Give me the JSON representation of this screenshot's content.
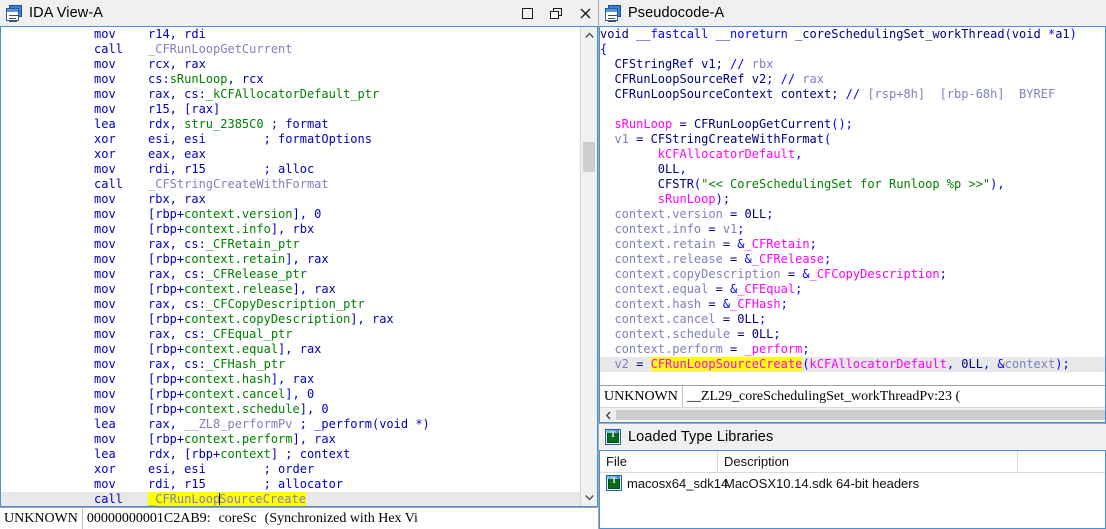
{
  "left_pane": {
    "title": "IDA View-A",
    "icon": "ida-view-icon",
    "window_buttons": {
      "maximize": "maximize-icon",
      "restore": "restore-icon",
      "close": "close-icon"
    },
    "disassembly": [
      {
        "mnemonic": "mov",
        "operands": [
          {
            "t": "reg",
            "v": "r14, rdi"
          }
        ]
      },
      {
        "mnemonic": "call",
        "operands": [
          {
            "t": "gsym",
            "v": "_CFRunLoopGetCurrent"
          }
        ]
      },
      {
        "mnemonic": "mov",
        "operands": [
          {
            "t": "reg",
            "v": "rcx, rax"
          }
        ]
      },
      {
        "mnemonic": "mov",
        "operands": [
          {
            "t": "reg",
            "v": "cs:"
          },
          {
            "t": "memb",
            "v": "sRunLoop"
          },
          {
            "t": "reg",
            "v": ", rcx"
          }
        ]
      },
      {
        "mnemonic": "mov",
        "operands": [
          {
            "t": "reg",
            "v": "rax, cs:"
          },
          {
            "t": "memb",
            "v": "_kCFAllocatorDefault_ptr"
          }
        ]
      },
      {
        "mnemonic": "mov",
        "operands": [
          {
            "t": "reg",
            "v": "r15, [rax]"
          }
        ]
      },
      {
        "mnemonic": "lea",
        "operands": [
          {
            "t": "reg",
            "v": "rdx, "
          },
          {
            "t": "memb",
            "v": "stru_2385C0"
          },
          {
            "t": "reg",
            "v": " ; "
          },
          {
            "t": "cmt",
            "v": "format"
          }
        ]
      },
      {
        "mnemonic": "xor",
        "operands": [
          {
            "t": "reg",
            "v": "esi, esi        ; "
          },
          {
            "t": "cmt",
            "v": "formatOptions"
          }
        ]
      },
      {
        "mnemonic": "xor",
        "operands": [
          {
            "t": "reg",
            "v": "eax, eax"
          }
        ]
      },
      {
        "mnemonic": "mov",
        "operands": [
          {
            "t": "reg",
            "v": "rdi, r15        ; "
          },
          {
            "t": "cmt",
            "v": "alloc"
          }
        ]
      },
      {
        "mnemonic": "call",
        "operands": [
          {
            "t": "gsym",
            "v": "_CFStringCreateWithFormat"
          }
        ]
      },
      {
        "mnemonic": "mov",
        "operands": [
          {
            "t": "reg",
            "v": "rbx, rax"
          }
        ]
      },
      {
        "mnemonic": "mov",
        "operands": [
          {
            "t": "reg",
            "v": "[rbp+"
          },
          {
            "t": "memb",
            "v": "context.version"
          },
          {
            "t": "reg",
            "v": "], 0"
          }
        ]
      },
      {
        "mnemonic": "mov",
        "operands": [
          {
            "t": "reg",
            "v": "[rbp+"
          },
          {
            "t": "memb",
            "v": "context.info"
          },
          {
            "t": "reg",
            "v": "], rbx"
          }
        ]
      },
      {
        "mnemonic": "mov",
        "operands": [
          {
            "t": "reg",
            "v": "rax, cs:"
          },
          {
            "t": "memb",
            "v": "_CFRetain_ptr"
          }
        ]
      },
      {
        "mnemonic": "mov",
        "operands": [
          {
            "t": "reg",
            "v": "[rbp+"
          },
          {
            "t": "memb",
            "v": "context.retain"
          },
          {
            "t": "reg",
            "v": "], rax"
          }
        ]
      },
      {
        "mnemonic": "mov",
        "operands": [
          {
            "t": "reg",
            "v": "rax, cs:"
          },
          {
            "t": "memb",
            "v": "_CFRelease_ptr"
          }
        ]
      },
      {
        "mnemonic": "mov",
        "operands": [
          {
            "t": "reg",
            "v": "[rbp+"
          },
          {
            "t": "memb",
            "v": "context.release"
          },
          {
            "t": "reg",
            "v": "], rax"
          }
        ]
      },
      {
        "mnemonic": "mov",
        "operands": [
          {
            "t": "reg",
            "v": "rax, cs:"
          },
          {
            "t": "memb",
            "v": "_CFCopyDescription_ptr"
          }
        ]
      },
      {
        "mnemonic": "mov",
        "operands": [
          {
            "t": "reg",
            "v": "[rbp+"
          },
          {
            "t": "memb",
            "v": "context.copyDescription"
          },
          {
            "t": "reg",
            "v": "], rax"
          }
        ]
      },
      {
        "mnemonic": "mov",
        "operands": [
          {
            "t": "reg",
            "v": "rax, cs:"
          },
          {
            "t": "memb",
            "v": "_CFEqual_ptr"
          }
        ]
      },
      {
        "mnemonic": "mov",
        "operands": [
          {
            "t": "reg",
            "v": "[rbp+"
          },
          {
            "t": "memb",
            "v": "context.equal"
          },
          {
            "t": "reg",
            "v": "], rax"
          }
        ]
      },
      {
        "mnemonic": "mov",
        "operands": [
          {
            "t": "reg",
            "v": "rax, cs:"
          },
          {
            "t": "memb",
            "v": "_CFHash_ptr"
          }
        ]
      },
      {
        "mnemonic": "mov",
        "operands": [
          {
            "t": "reg",
            "v": "[rbp+"
          },
          {
            "t": "memb",
            "v": "context.hash"
          },
          {
            "t": "reg",
            "v": "], rax"
          }
        ]
      },
      {
        "mnemonic": "mov",
        "operands": [
          {
            "t": "reg",
            "v": "[rbp+"
          },
          {
            "t": "memb",
            "v": "context.cancel"
          },
          {
            "t": "reg",
            "v": "], 0"
          }
        ]
      },
      {
        "mnemonic": "mov",
        "operands": [
          {
            "t": "reg",
            "v": "[rbp+"
          },
          {
            "t": "memb",
            "v": "context.schedule"
          },
          {
            "t": "reg",
            "v": "], 0"
          }
        ]
      },
      {
        "mnemonic": "lea",
        "operands": [
          {
            "t": "reg",
            "v": "rax, "
          },
          {
            "t": "gsym",
            "v": "__ZL8_performPv"
          },
          {
            "t": "reg",
            "v": " ; "
          },
          {
            "t": "cmt",
            "v": "_perform(void *)"
          }
        ]
      },
      {
        "mnemonic": "mov",
        "operands": [
          {
            "t": "reg",
            "v": "[rbp+"
          },
          {
            "t": "memb",
            "v": "context.perform"
          },
          {
            "t": "reg",
            "v": "], rax"
          }
        ]
      },
      {
        "mnemonic": "lea",
        "operands": [
          {
            "t": "reg",
            "v": "rdx, [rbp+"
          },
          {
            "t": "memb",
            "v": "context"
          },
          {
            "t": "reg",
            "v": "] ; "
          },
          {
            "t": "cmt",
            "v": "context"
          }
        ]
      },
      {
        "mnemonic": "xor",
        "operands": [
          {
            "t": "reg",
            "v": "esi, esi        ; "
          },
          {
            "t": "cmt",
            "v": "order"
          }
        ]
      },
      {
        "mnemonic": "mov",
        "operands": [
          {
            "t": "reg",
            "v": "rdi, r15        ; "
          },
          {
            "t": "cmt",
            "v": "allocator"
          }
        ]
      },
      {
        "mnemonic": "call",
        "operands": [
          {
            "t": "hl-gsym-caret",
            "v": "_CFRunLoopSourceCreate",
            "caret_after": 10
          }
        ],
        "current": true
      }
    ],
    "status": {
      "segment": "UNKNOWN",
      "address": "00000000001C2AB9:",
      "name": "coreSc",
      "sync": "(Synchronized with Hex Vi"
    }
  },
  "right_pane": {
    "pseudocode": {
      "title": "Pseudocode-A",
      "icon": "pseudocode-icon",
      "lines": [
        [
          {
            "t": "typ",
            "v": "void "
          },
          {
            "t": "kw",
            "v": "__fastcall __noreturn "
          },
          {
            "t": "typ",
            "v": "_coreSchedulingSet_workThread"
          },
          {
            "t": "punct",
            "v": "("
          },
          {
            "t": "typ",
            "v": "void "
          },
          {
            "t": "punct",
            "v": "*"
          },
          {
            "t": "lit",
            "v": "a1"
          },
          {
            "t": "punct",
            "v": ")"
          }
        ],
        [
          {
            "t": "punct",
            "v": "{"
          }
        ],
        [
          {
            "t": "plain",
            "v": "  "
          },
          {
            "t": "typ",
            "v": "CFStringRef v1; "
          },
          {
            "t": "cm",
            "v": "// "
          },
          {
            "t": "var",
            "v": "rbx"
          }
        ],
        [
          {
            "t": "plain",
            "v": "  "
          },
          {
            "t": "typ",
            "v": "CFRunLoopSourceRef v2; "
          },
          {
            "t": "cm",
            "v": "// "
          },
          {
            "t": "var",
            "v": "rax"
          }
        ],
        [
          {
            "t": "plain",
            "v": "  "
          },
          {
            "t": "typ",
            "v": "CFRunLoopSourceContext context; "
          },
          {
            "t": "cm",
            "v": "// "
          },
          {
            "t": "var",
            "v": "[rsp+8h]  [rbp-68h]  BYREF"
          }
        ],
        [],
        [
          {
            "t": "plain",
            "v": "  "
          },
          {
            "t": "glob",
            "v": "sRunLoop"
          },
          {
            "t": "typ",
            "v": " = "
          },
          {
            "t": "typ",
            "v": "CFRunLoopGetCurrent"
          },
          {
            "t": "punct",
            "v": "();"
          }
        ],
        [
          {
            "t": "plain",
            "v": "  "
          },
          {
            "t": "var",
            "v": "v1"
          },
          {
            "t": "typ",
            "v": " = "
          },
          {
            "t": "typ",
            "v": "CFStringCreateWithFormat"
          },
          {
            "t": "punct",
            "v": "("
          }
        ],
        [
          {
            "t": "plain",
            "v": "        "
          },
          {
            "t": "glob",
            "v": "kCFAllocatorDefault"
          },
          {
            "t": "punct",
            "v": ","
          }
        ],
        [
          {
            "t": "plain",
            "v": "        "
          },
          {
            "t": "lit",
            "v": "0LL"
          },
          {
            "t": "punct",
            "v": ","
          }
        ],
        [
          {
            "t": "plain",
            "v": "        "
          },
          {
            "t": "typ",
            "v": "CFSTR"
          },
          {
            "t": "punct",
            "v": "("
          },
          {
            "t": "str",
            "v": "\"<< CoreSchedulingSet for Runloop %p >>\""
          },
          {
            "t": "punct",
            "v": "),"
          }
        ],
        [
          {
            "t": "plain",
            "v": "        "
          },
          {
            "t": "glob",
            "v": "sRunLoop"
          },
          {
            "t": "punct",
            "v": ");"
          }
        ],
        [
          {
            "t": "plain",
            "v": "  "
          },
          {
            "t": "var",
            "v": "context.version"
          },
          {
            "t": "typ",
            "v": " = "
          },
          {
            "t": "lit",
            "v": "0LL"
          },
          {
            "t": "punct",
            "v": ";"
          }
        ],
        [
          {
            "t": "plain",
            "v": "  "
          },
          {
            "t": "var",
            "v": "context.info"
          },
          {
            "t": "typ",
            "v": " = "
          },
          {
            "t": "var",
            "v": "v1"
          },
          {
            "t": "punct",
            "v": ";"
          }
        ],
        [
          {
            "t": "plain",
            "v": "  "
          },
          {
            "t": "var",
            "v": "context.retain"
          },
          {
            "t": "typ",
            "v": " = "
          },
          {
            "t": "punct",
            "v": "&"
          },
          {
            "t": "glob",
            "v": "_CFRetain"
          },
          {
            "t": "punct",
            "v": ";"
          }
        ],
        [
          {
            "t": "plain",
            "v": "  "
          },
          {
            "t": "var",
            "v": "context.release"
          },
          {
            "t": "typ",
            "v": " = "
          },
          {
            "t": "punct",
            "v": "&"
          },
          {
            "t": "glob",
            "v": "_CFRelease"
          },
          {
            "t": "punct",
            "v": ";"
          }
        ],
        [
          {
            "t": "plain",
            "v": "  "
          },
          {
            "t": "var",
            "v": "context.copyDescription"
          },
          {
            "t": "typ",
            "v": " = "
          },
          {
            "t": "punct",
            "v": "&"
          },
          {
            "t": "glob",
            "v": "_CFCopyDescription"
          },
          {
            "t": "punct",
            "v": ";"
          }
        ],
        [
          {
            "t": "plain",
            "v": "  "
          },
          {
            "t": "var",
            "v": "context.equal"
          },
          {
            "t": "typ",
            "v": " = "
          },
          {
            "t": "punct",
            "v": "&"
          },
          {
            "t": "glob",
            "v": "_CFEqual"
          },
          {
            "t": "punct",
            "v": ";"
          }
        ],
        [
          {
            "t": "plain",
            "v": "  "
          },
          {
            "t": "var",
            "v": "context.hash"
          },
          {
            "t": "typ",
            "v": " = "
          },
          {
            "t": "punct",
            "v": "&"
          },
          {
            "t": "glob",
            "v": "_CFHash"
          },
          {
            "t": "punct",
            "v": ";"
          }
        ],
        [
          {
            "t": "plain",
            "v": "  "
          },
          {
            "t": "var",
            "v": "context.cancel"
          },
          {
            "t": "typ",
            "v": " = "
          },
          {
            "t": "lit",
            "v": "0LL"
          },
          {
            "t": "punct",
            "v": ";"
          }
        ],
        [
          {
            "t": "plain",
            "v": "  "
          },
          {
            "t": "var",
            "v": "context.schedule"
          },
          {
            "t": "typ",
            "v": " = "
          },
          {
            "t": "lit",
            "v": "0LL"
          },
          {
            "t": "punct",
            "v": ";"
          }
        ],
        [
          {
            "t": "plain",
            "v": "  "
          },
          {
            "t": "var",
            "v": "context.perform"
          },
          {
            "t": "typ",
            "v": " = "
          },
          {
            "t": "glob",
            "v": "_perform"
          },
          {
            "t": "punct",
            "v": ";"
          }
        ],
        [
          {
            "t": "plain",
            "v": "  "
          },
          {
            "t": "var",
            "v": "v2"
          },
          {
            "t": "typ",
            "v": " = "
          },
          {
            "t": "hl",
            "v": "CFRunLoopSourceCreate"
          },
          {
            "t": "punct",
            "v": "("
          },
          {
            "t": "glob",
            "v": "kCFAllocatorDefault"
          },
          {
            "t": "punct",
            "v": ", "
          },
          {
            "t": "lit",
            "v": "0LL"
          },
          {
            "t": "punct",
            "v": ", &"
          },
          {
            "t": "var",
            "v": "context"
          },
          {
            "t": "punct",
            "v": ");"
          }
        ]
      ],
      "current_line_index": 22,
      "status": {
        "segment": "UNKNOWN",
        "location": "__ZL29_coreSchedulingSet_workThreadPv:23  ("
      },
      "hscroll_left_arrow": "chevron-left-icon"
    },
    "type_libraries": {
      "title": "Loaded Type Libraries",
      "icon": "type-library-icon",
      "columns": [
        "File",
        "Description"
      ],
      "rows": [
        {
          "icon": "type-library-icon",
          "file": "macosx64_sdk14",
          "description": "MacOSX10.14.sdk 64-bit headers"
        }
      ]
    }
  },
  "colors": {
    "accent_border": "#4a90d9",
    "highlight": "#ffff00",
    "current_line": "#e8e8e8",
    "titlebar_bg": "#f0f0f0",
    "member_green": "#008000",
    "global_magenta": "#ff00ff",
    "symbol_lavender": "#8080c0"
  }
}
